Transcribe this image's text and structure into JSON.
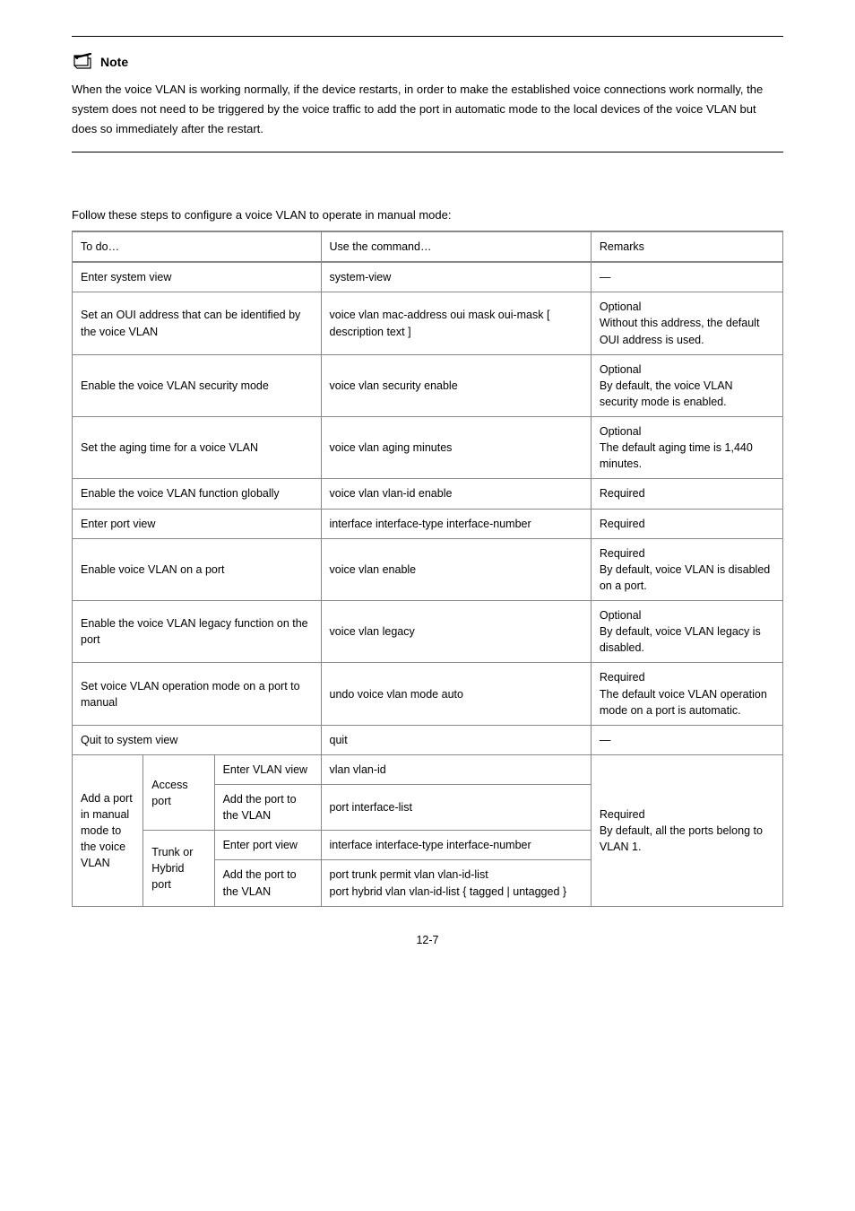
{
  "note": {
    "label": "Note",
    "body": "When the voice VLAN is working normally, if the device restarts, in order to make the established voice connections work normally, the system does not need to be triggered by the voice traffic to add the port in automatic mode to the local devices of the voice VLAN but does so immediately after the restart."
  },
  "caption": "Follow these steps to configure a voice VLAN to operate in manual mode:",
  "header": {
    "todo": "To do…",
    "use": "Use the command…",
    "remarks": "Remarks"
  },
  "rows": {
    "r1": {
      "todo": "Enter system view",
      "use": "system-view",
      "rem": "—"
    },
    "r2": {
      "todo": "Set an OUI address that can be identified by the voice VLAN",
      "use": "voice vlan mac-address oui mask oui-mask [ description text ]",
      "rem": "Optional\nWithout this address, the default OUI address is used."
    },
    "r3": {
      "todo": "Enable the voice VLAN security mode",
      "use": "voice vlan security enable",
      "rem": "Optional\nBy default, the voice VLAN security mode is enabled."
    },
    "r4": {
      "todo": "Set the aging time for a voice VLAN",
      "use": "voice vlan aging minutes",
      "rem": "Optional\nThe default aging time is 1,440 minutes."
    },
    "r5": {
      "todo": "Enable the voice VLAN function globally",
      "use": "voice vlan vlan-id enable",
      "rem": "Required"
    },
    "r6": {
      "todo": "Enter port view",
      "use": "interface interface-type interface-number",
      "rem": "Required"
    },
    "r7": {
      "todo": "Enable voice VLAN on a port",
      "use": "voice vlan enable",
      "rem": "Required\nBy default, voice VLAN is disabled on a port."
    },
    "r8": {
      "todo": "Enable the voice VLAN legacy function on the port",
      "use": "voice vlan legacy",
      "rem": "Optional\nBy default, voice VLAN legacy is disabled."
    },
    "r9": {
      "todo": "Set voice VLAN operation mode on a port to manual",
      "use": "undo voice vlan mode auto",
      "rem": "Required\nThe default voice VLAN operation mode on a port is automatic."
    },
    "r10": {
      "todo": "Quit to system view",
      "use": "quit",
      "rem": "—"
    },
    "r11_group": "Add a port in manual mode to the voice VLAN",
    "r11a_port": "Access port",
    "r11a1": {
      "todo": "Enter VLAN view",
      "use": "vlan vlan-id"
    },
    "r11a2": {
      "todo": "Add the port to the VLAN",
      "use": "port interface-list"
    },
    "r11b_port": "Trunk or Hybrid port",
    "r11b1": {
      "todo": "Enter port view",
      "use": "interface interface-type interface-number"
    },
    "r11b2": {
      "todo": "Add the port to the VLAN",
      "use": "port trunk permit vlan vlan-id-list\nport hybrid vlan vlan-id-list { tagged | untagged }"
    },
    "r11_rem": "Required\nBy default, all the ports belong to VLAN 1."
  },
  "page": "12-7"
}
